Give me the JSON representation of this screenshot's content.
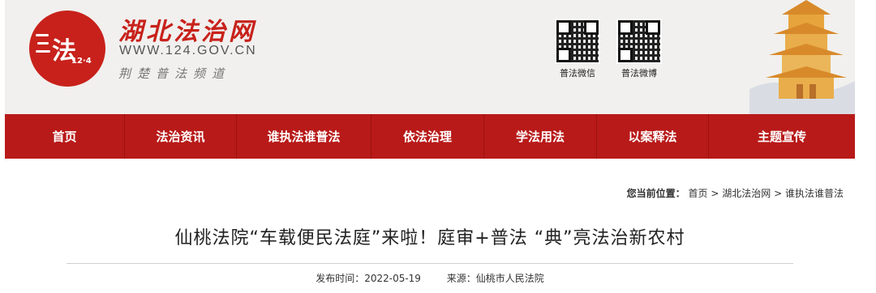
{
  "header": {
    "site_title": "湖北法治网",
    "site_url": "WWW.124.GOV.CN",
    "slogan": "荆楚普法频道",
    "logo_char": "法",
    "logo_number": "12·4",
    "qr_wechat_label": "普法微信",
    "qr_weibo_label": "普法微博"
  },
  "nav": {
    "items": [
      {
        "label": "首页"
      },
      {
        "label": "法治资讯"
      },
      {
        "label": "谁执法谁普法"
      },
      {
        "label": "依法治理"
      },
      {
        "label": "学法用法"
      },
      {
        "label": "以案释法"
      },
      {
        "label": "主题宣传"
      }
    ]
  },
  "breadcrumb": {
    "prefix": "您当前位置：",
    "items": [
      "首页",
      "湖北法治网",
      "谁执法谁普法"
    ],
    "separator": ">"
  },
  "article": {
    "title": "仙桃法院“车载便民法庭”来啦！庭审+普法 “典”亮法治新农村",
    "publish_time_label": "发布时间：",
    "publish_time": "2022-05-19",
    "source_label": "来源：",
    "source": "仙桃市人民法院"
  },
  "colors": {
    "brand_red": "#b81a19",
    "logo_red": "#c8211b",
    "header_bg": "#f1f0ee"
  }
}
